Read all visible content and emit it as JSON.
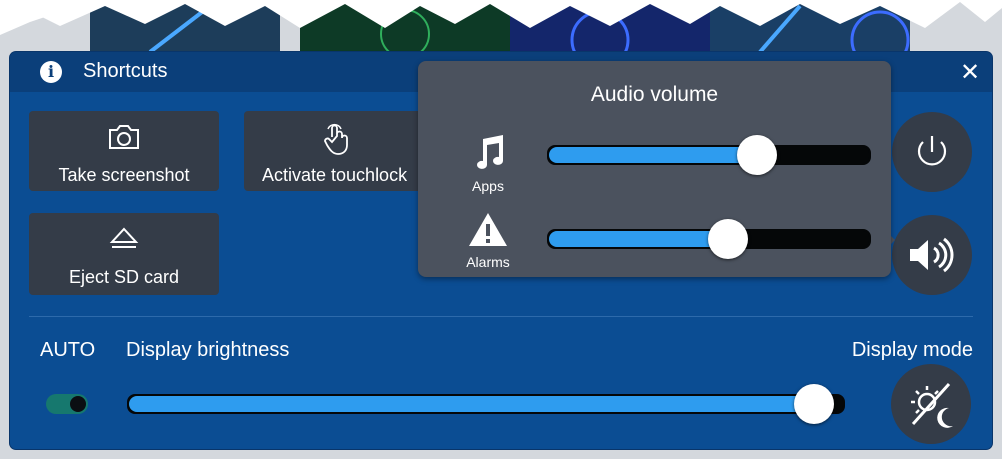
{
  "panel": {
    "title": "Shortcuts",
    "shortcuts": [
      {
        "label": "Take screenshot",
        "icon": "camera-icon"
      },
      {
        "label": "Activate touchlock",
        "icon": "touch-hand-icon"
      },
      {
        "label": "Eject SD card",
        "icon": "eject-icon"
      }
    ],
    "auto_label": "AUTO",
    "auto_enabled": true,
    "brightness_label": "Display brightness",
    "brightness_level": 0.96,
    "display_mode_label": "Display mode"
  },
  "audio_popup": {
    "title": "Audio volume",
    "channels": [
      {
        "label": "Apps",
        "icon": "music-note-icon",
        "level": 0.65
      },
      {
        "label": "Alarms",
        "icon": "warning-icon",
        "level": 0.56
      }
    ]
  },
  "colors": {
    "panel": "#0b4d93",
    "header": "#0b3f7a",
    "tile": "#343c48",
    "popup": "#4b525e",
    "slider_fill": "#2e9cef",
    "toggle_on": "#16786e"
  }
}
